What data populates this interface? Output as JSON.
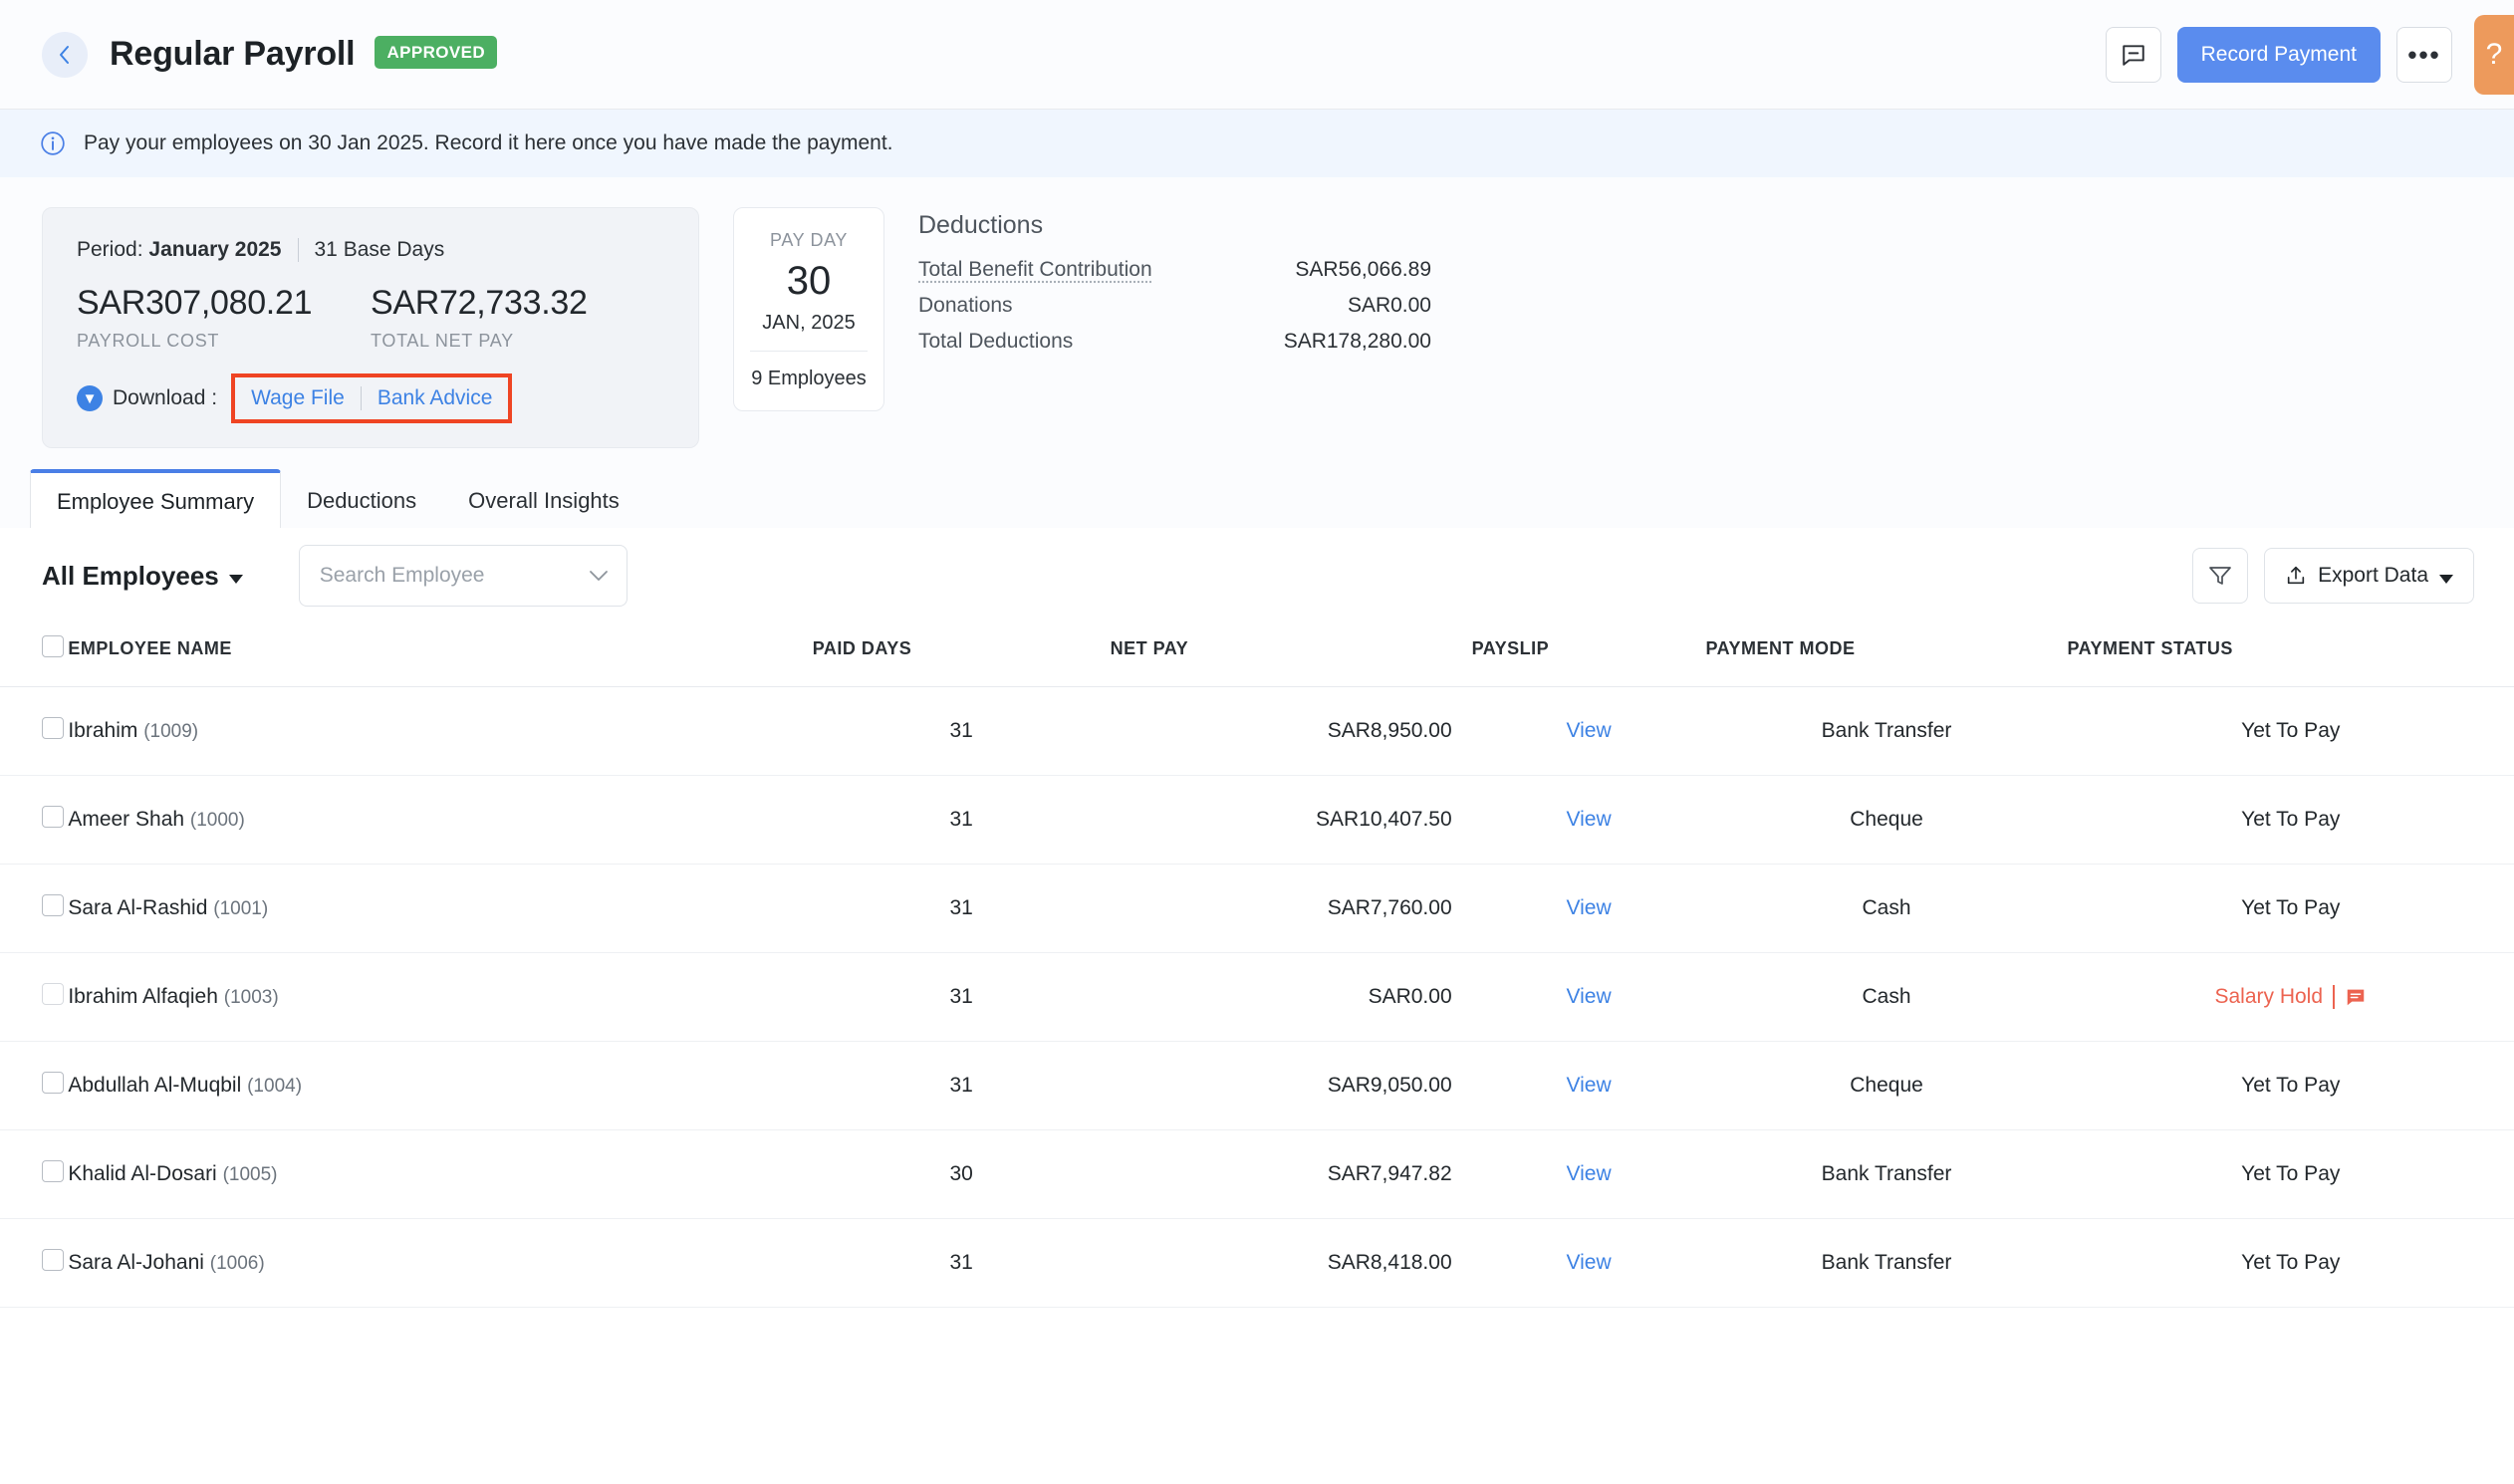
{
  "header": {
    "back_label": "‹",
    "title": "Regular Payroll",
    "status": "APPROVED",
    "comment_icon": "comment-icon",
    "record_payment_label": "Record Payment",
    "more_label": "•••",
    "help_label": "?"
  },
  "banner": {
    "icon": "info-icon",
    "message": "Pay your employees on 30 Jan 2025. Record it here once you have made the payment."
  },
  "period_card": {
    "period_prefix": "Period:",
    "period_value": "January 2025",
    "base_days": "31 Base Days",
    "payroll_cost_value": "SAR307,080.21",
    "payroll_cost_label": "PAYROLL COST",
    "total_net_pay_value": "SAR72,733.32",
    "total_net_pay_label": "TOTAL NET PAY",
    "download_label": "Download :",
    "wage_file_link": "Wage File",
    "bank_advice_link": "Bank Advice",
    "highlight_color": "#ef4423"
  },
  "payday_card": {
    "label": "PAY DAY",
    "day": "30",
    "month_year": "JAN, 2025",
    "employees": "9 Employees"
  },
  "deductions": {
    "title": "Deductions",
    "rows": [
      {
        "name": "Total Benefit Contribution",
        "value": "SAR56,066.89"
      },
      {
        "name": "Donations",
        "value": "SAR0.00"
      },
      {
        "name": "Total Deductions",
        "value": "SAR178,280.00"
      }
    ]
  },
  "tabs": [
    {
      "label": "Employee Summary",
      "active": true
    },
    {
      "label": "Deductions",
      "active": false
    },
    {
      "label": "Overall Insights",
      "active": false
    }
  ],
  "toolbar": {
    "all_employees_label": "All Employees",
    "search_placeholder": "Search Employee",
    "search_value": "",
    "filter_icon": "filter-icon",
    "export_label": "Export Data",
    "export_icon": "upload-icon"
  },
  "table": {
    "columns": [
      "EMPLOYEE NAME",
      "PAID DAYS",
      "NET PAY",
      "PAYSLIP",
      "PAYMENT MODE",
      "PAYMENT STATUS"
    ],
    "rows": [
      {
        "name": "Ibrahim",
        "id": "(1009)",
        "paid_days": "31",
        "net_pay": "SAR8,950.00",
        "payslip": "View",
        "mode": "Bank Transfer",
        "status": "Yet To Pay",
        "hold": false
      },
      {
        "name": "Ameer Shah",
        "id": "(1000)",
        "paid_days": "31",
        "net_pay": "SAR10,407.50",
        "payslip": "View",
        "mode": "Cheque",
        "status": "Yet To Pay",
        "hold": false
      },
      {
        "name": "Sara Al-Rashid",
        "id": "(1001)",
        "paid_days": "31",
        "net_pay": "SAR7,760.00",
        "payslip": "View",
        "mode": "Cash",
        "status": "Yet To Pay",
        "hold": false
      },
      {
        "name": "Ibrahim Alfaqieh",
        "id": "(1003)",
        "paid_days": "31",
        "net_pay": "SAR0.00",
        "payslip": "View",
        "mode": "Cash",
        "status": "Salary Hold",
        "hold": true
      },
      {
        "name": "Abdullah Al-Muqbil",
        "id": "(1004)",
        "paid_days": "31",
        "net_pay": "SAR9,050.00",
        "payslip": "View",
        "mode": "Cheque",
        "status": "Yet To Pay",
        "hold": false
      },
      {
        "name": "Khalid Al-Dosari",
        "id": "(1005)",
        "paid_days": "30",
        "net_pay": "SAR7,947.82",
        "payslip": "View",
        "mode": "Bank Transfer",
        "status": "Yet To Pay",
        "hold": false
      },
      {
        "name": "Sara Al-Johani",
        "id": "(1006)",
        "paid_days": "31",
        "net_pay": "SAR8,418.00",
        "payslip": "View",
        "mode": "Bank Transfer",
        "status": "Yet To Pay",
        "hold": false
      }
    ]
  }
}
